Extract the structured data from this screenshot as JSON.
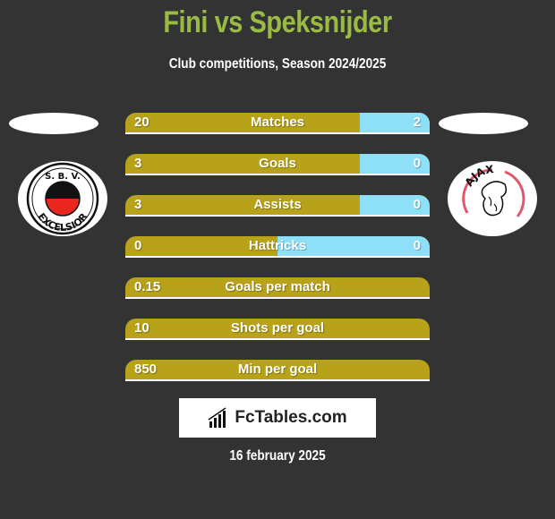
{
  "header": {
    "title": "Fini vs Speksnijder",
    "subtitle": "Club competitions, Season 2024/2025"
  },
  "players": {
    "left": {
      "club": "S.B.V. Excelsior",
      "logo_text_top": "S. B. V.",
      "logo_text_bottom": "EXCELSIOR"
    },
    "right": {
      "club": "Ajax Amsterdam",
      "logo_text_top": "AJAX"
    }
  },
  "colors": {
    "left_bar": "#b8a21a",
    "right_bar": "#8ee0f8",
    "title": "#99bb44",
    "background": "#333333"
  },
  "stats": [
    {
      "label": "Matches",
      "left": "20",
      "right": "2",
      "left_share": 0.77
    },
    {
      "label": "Goals",
      "left": "3",
      "right": "0",
      "left_share": 0.77
    },
    {
      "label": "Assists",
      "left": "3",
      "right": "0",
      "left_share": 0.77
    },
    {
      "label": "Hattricks",
      "left": "0",
      "right": "0",
      "left_share": 0.5
    },
    {
      "label": "Goals per match",
      "left": "0.15",
      "right": "",
      "left_share": 1.0
    },
    {
      "label": "Shots per goal",
      "left": "10",
      "right": "",
      "left_share": 1.0
    },
    {
      "label": "Min per goal",
      "left": "850",
      "right": "",
      "left_share": 1.0
    }
  ],
  "footer": {
    "brand": "FcTables.com",
    "date": "16 february 2025"
  }
}
